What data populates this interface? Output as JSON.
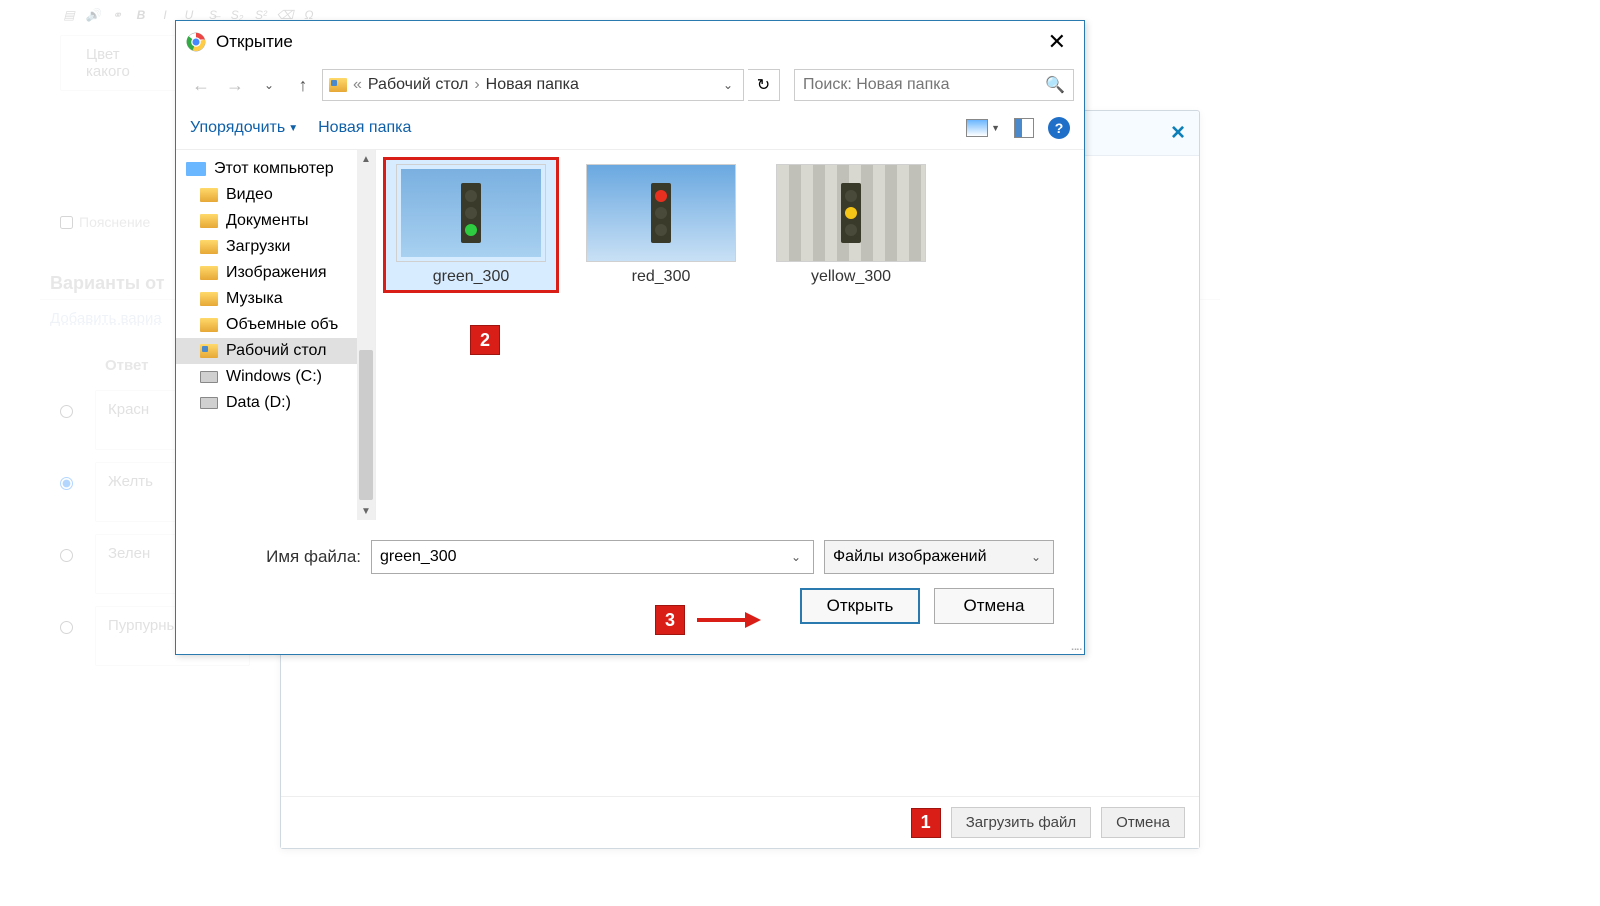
{
  "editor": {
    "prompt_placeholder": "Цвет какого",
    "explanation_checkbox": "Пояснение",
    "variants_title": "Варианты от",
    "add_variant": "Добавить вариа",
    "answer_header": "Ответ",
    "answers": [
      "Красн",
      "Желть",
      "Зелен",
      "Пурпурный"
    ]
  },
  "upload_dialog": {
    "upload_btn": "Загрузить файл",
    "cancel_btn": "Отмена"
  },
  "file_dialog": {
    "title": "Открытие",
    "breadcrumb_part1": "Рабочий стол",
    "breadcrumb_part2": "Новая папка",
    "search_placeholder": "Поиск: Новая папка",
    "organize": "Упорядочить",
    "new_folder": "Новая папка",
    "tree": {
      "root": "Этот компьютер",
      "items": [
        "Видео",
        "Документы",
        "Загрузки",
        "Изображения",
        "Музыка",
        "Объемные объ",
        "Рабочий стол",
        "Windows (C:)",
        "Data (D:)"
      ]
    },
    "files": [
      {
        "label": "green_300",
        "color": "green",
        "selected": true
      },
      {
        "label": "red_300",
        "color": "red",
        "selected": false
      },
      {
        "label": "yellow_300",
        "color": "yellow",
        "selected": false
      }
    ],
    "filename_label": "Имя файла:",
    "filename_value": "green_300",
    "filter_label": "Файлы изображений",
    "open_btn": "Открыть",
    "cancel_btn": "Отмена"
  },
  "markers": {
    "m1": "1",
    "m2": "2",
    "m3": "3"
  }
}
